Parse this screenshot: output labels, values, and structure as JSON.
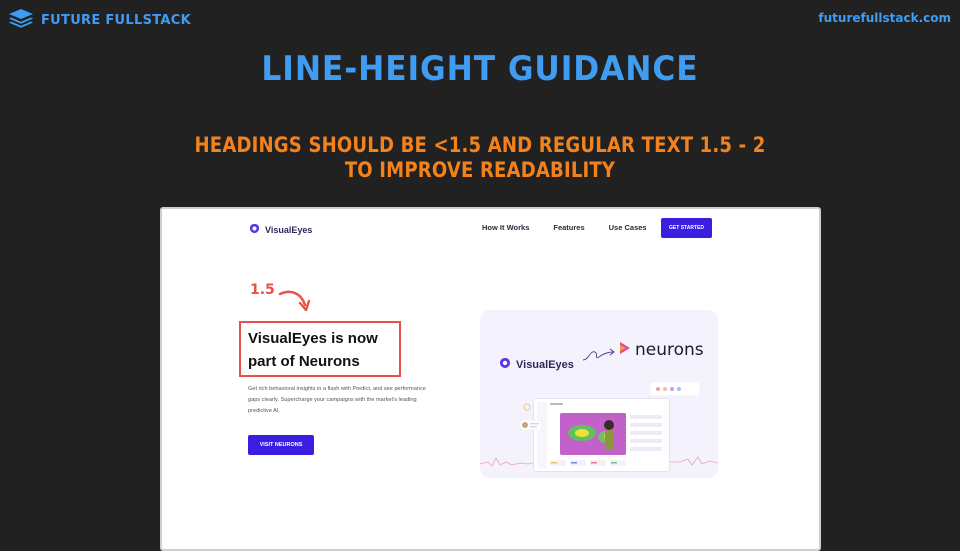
{
  "header": {
    "brand_name": "FUTURE FULLSTACK",
    "site_url": "futurefullstack.com",
    "brand_icon": "layers-icon"
  },
  "slide": {
    "title": "LINE-HEIGHT GUIDANCE",
    "subtitle_line1": "HEADINGS SHOULD BE <1.5 AND REGULAR TEXT 1.5 - 2",
    "subtitle_line2": "TO IMPROVE READABILITY"
  },
  "colors": {
    "background": "#212121",
    "title_blue": "#3f9cf2",
    "subtitle_orange": "#f3821d",
    "annotation_red": "#e8504c",
    "button_purple": "#3a1fe0"
  },
  "website": {
    "logo_text": "VisualEyes",
    "nav": [
      "How It Works",
      "Features",
      "Use Cases"
    ],
    "cta_label": "GET STARTED",
    "annotation": "1.5",
    "hero_heading_line1": "VisualEyes is now",
    "hero_heading_line2": "part of Neurons",
    "hero_paragraph_line1": "Get rich behavioral insights in a flash with Predict, and see performance",
    "hero_paragraph_line2": "gaps clearly. Supercharge your campaigns with the market's leading",
    "hero_paragraph_line3": "predictive AI.",
    "hero_button": "VISIT NEURONS",
    "card_visualeyes": "VisualEyes",
    "card_neurons": "neurons",
    "mini_brand": "neurons"
  }
}
